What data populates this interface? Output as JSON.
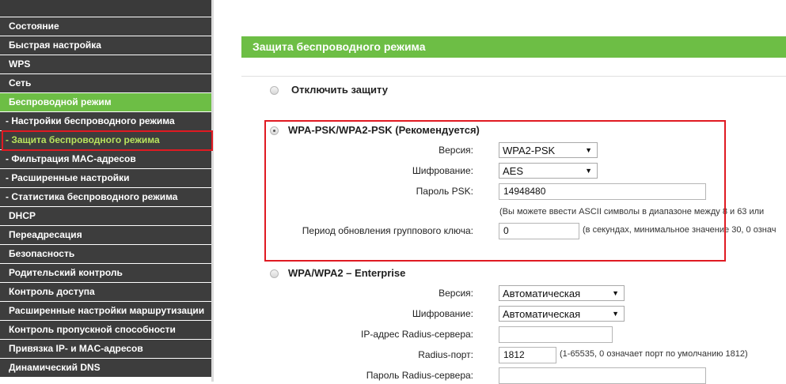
{
  "sidebar": {
    "items": [
      {
        "label": "Состояние"
      },
      {
        "label": "Быстрая настройка"
      },
      {
        "label": "WPS"
      },
      {
        "label": "Сеть"
      },
      {
        "label": "Беспроводной режим"
      },
      {
        "label": "- Настройки беспроводного режима"
      },
      {
        "label": "- Защита беспроводного режима"
      },
      {
        "label": "- Фильтрация MAC-адресов"
      },
      {
        "label": "- Расширенные настройки"
      },
      {
        "label": "- Статистика беспроводного режима"
      },
      {
        "label": "DHCP"
      },
      {
        "label": "Переадресация"
      },
      {
        "label": "Безопасность"
      },
      {
        "label": "Родительский контроль"
      },
      {
        "label": "Контроль доступа"
      },
      {
        "label": "Расширенные настройки маршрутизации"
      },
      {
        "label": "Контроль пропускной способности"
      },
      {
        "label": "Привязка IP- и MAC-адресов"
      },
      {
        "label": "Динамический DNS"
      }
    ]
  },
  "page": {
    "title": "Защита беспроводного режима"
  },
  "disable": {
    "label": "Отключить защиту"
  },
  "wpa_psk": {
    "label": "WPA-PSK/WPA2-PSK (Рекомендуется)",
    "version_label": "Версия:",
    "version_value": "WPA2-PSK",
    "encryption_label": "Шифрование:",
    "encryption_value": "AES",
    "password_label": "Пароль PSK:",
    "password_value": "14948480",
    "password_note": "(Вы можете ввести ASCII символы в диапазоне между 8 и 63 или",
    "group_key_label": "Период обновления группового ключа:",
    "group_key_value": "0",
    "group_key_note": "(в секундах, минимальное значение 30, 0 означ"
  },
  "enterprise": {
    "label": "WPA/WPA2 – Enterprise",
    "version_label": "Версия:",
    "version_value": "Автоматическая",
    "encryption_label": "Шифрование:",
    "encryption_value": "Автоматическая",
    "radius_ip_label": "IP-адрес Radius-сервера:",
    "radius_ip_value": "",
    "radius_port_label": "Radius-порт:",
    "radius_port_value": "1812",
    "radius_port_note": "(1-65535, 0 означает порт по умолчанию 1812)",
    "radius_password_label": "Пароль Radius-сервера:",
    "radius_password_value": ""
  },
  "colors": {
    "accent_green": "#6dbe45",
    "sidebar_dark": "#3d3d3d",
    "highlight_red": "#e01a22"
  }
}
